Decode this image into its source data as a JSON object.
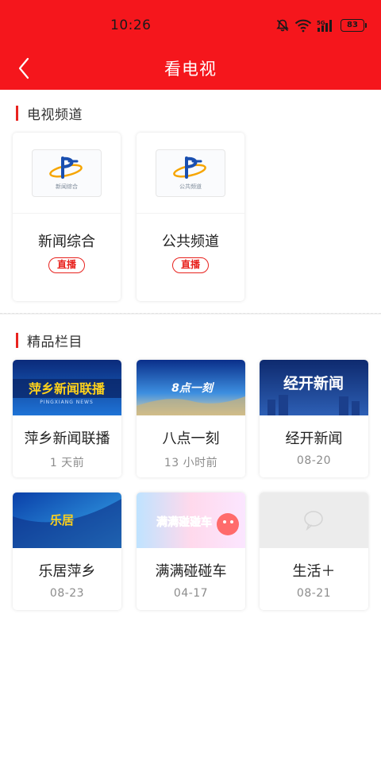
{
  "status_bar": {
    "time": "10:26",
    "battery": "83",
    "icons": [
      "mute-bell-icon",
      "wifi-icon",
      "signal-icon",
      "battery-icon"
    ]
  },
  "nav": {
    "title": "看电视",
    "back_icon": "chevron-left-icon",
    "color": "#f5161c"
  },
  "tv_section": {
    "title": "电视频道",
    "channels": [
      {
        "name": "新闻综合",
        "logo_text": "新闻综合",
        "badge": "直播"
      },
      {
        "name": "公共频道",
        "logo_text": "公共频道",
        "badge": "直播"
      }
    ]
  },
  "program_section": {
    "title": "精品栏目",
    "programs": [
      {
        "name": "萍乡新闻联播",
        "date": "1 天前",
        "thumb_title": "萍乡新闻联播",
        "thumb_sub": "PINGXIANG NEWS"
      },
      {
        "name": "八点一刻",
        "date": "13 小时前",
        "thumb_title": "8点一刻"
      },
      {
        "name": "经开新闻",
        "date": "08-20",
        "thumb_title": "经开新闻"
      },
      {
        "name": "乐居萍乡",
        "date": "08-23",
        "thumb_title": "乐居"
      },
      {
        "name": "满满碰碰车",
        "date": "04-17",
        "thumb_title": "满满碰碰车"
      },
      {
        "name": "生活＋",
        "date": "08-21"
      }
    ]
  },
  "colors": {
    "accent": "#e8231f",
    "header": "#f5161c"
  }
}
